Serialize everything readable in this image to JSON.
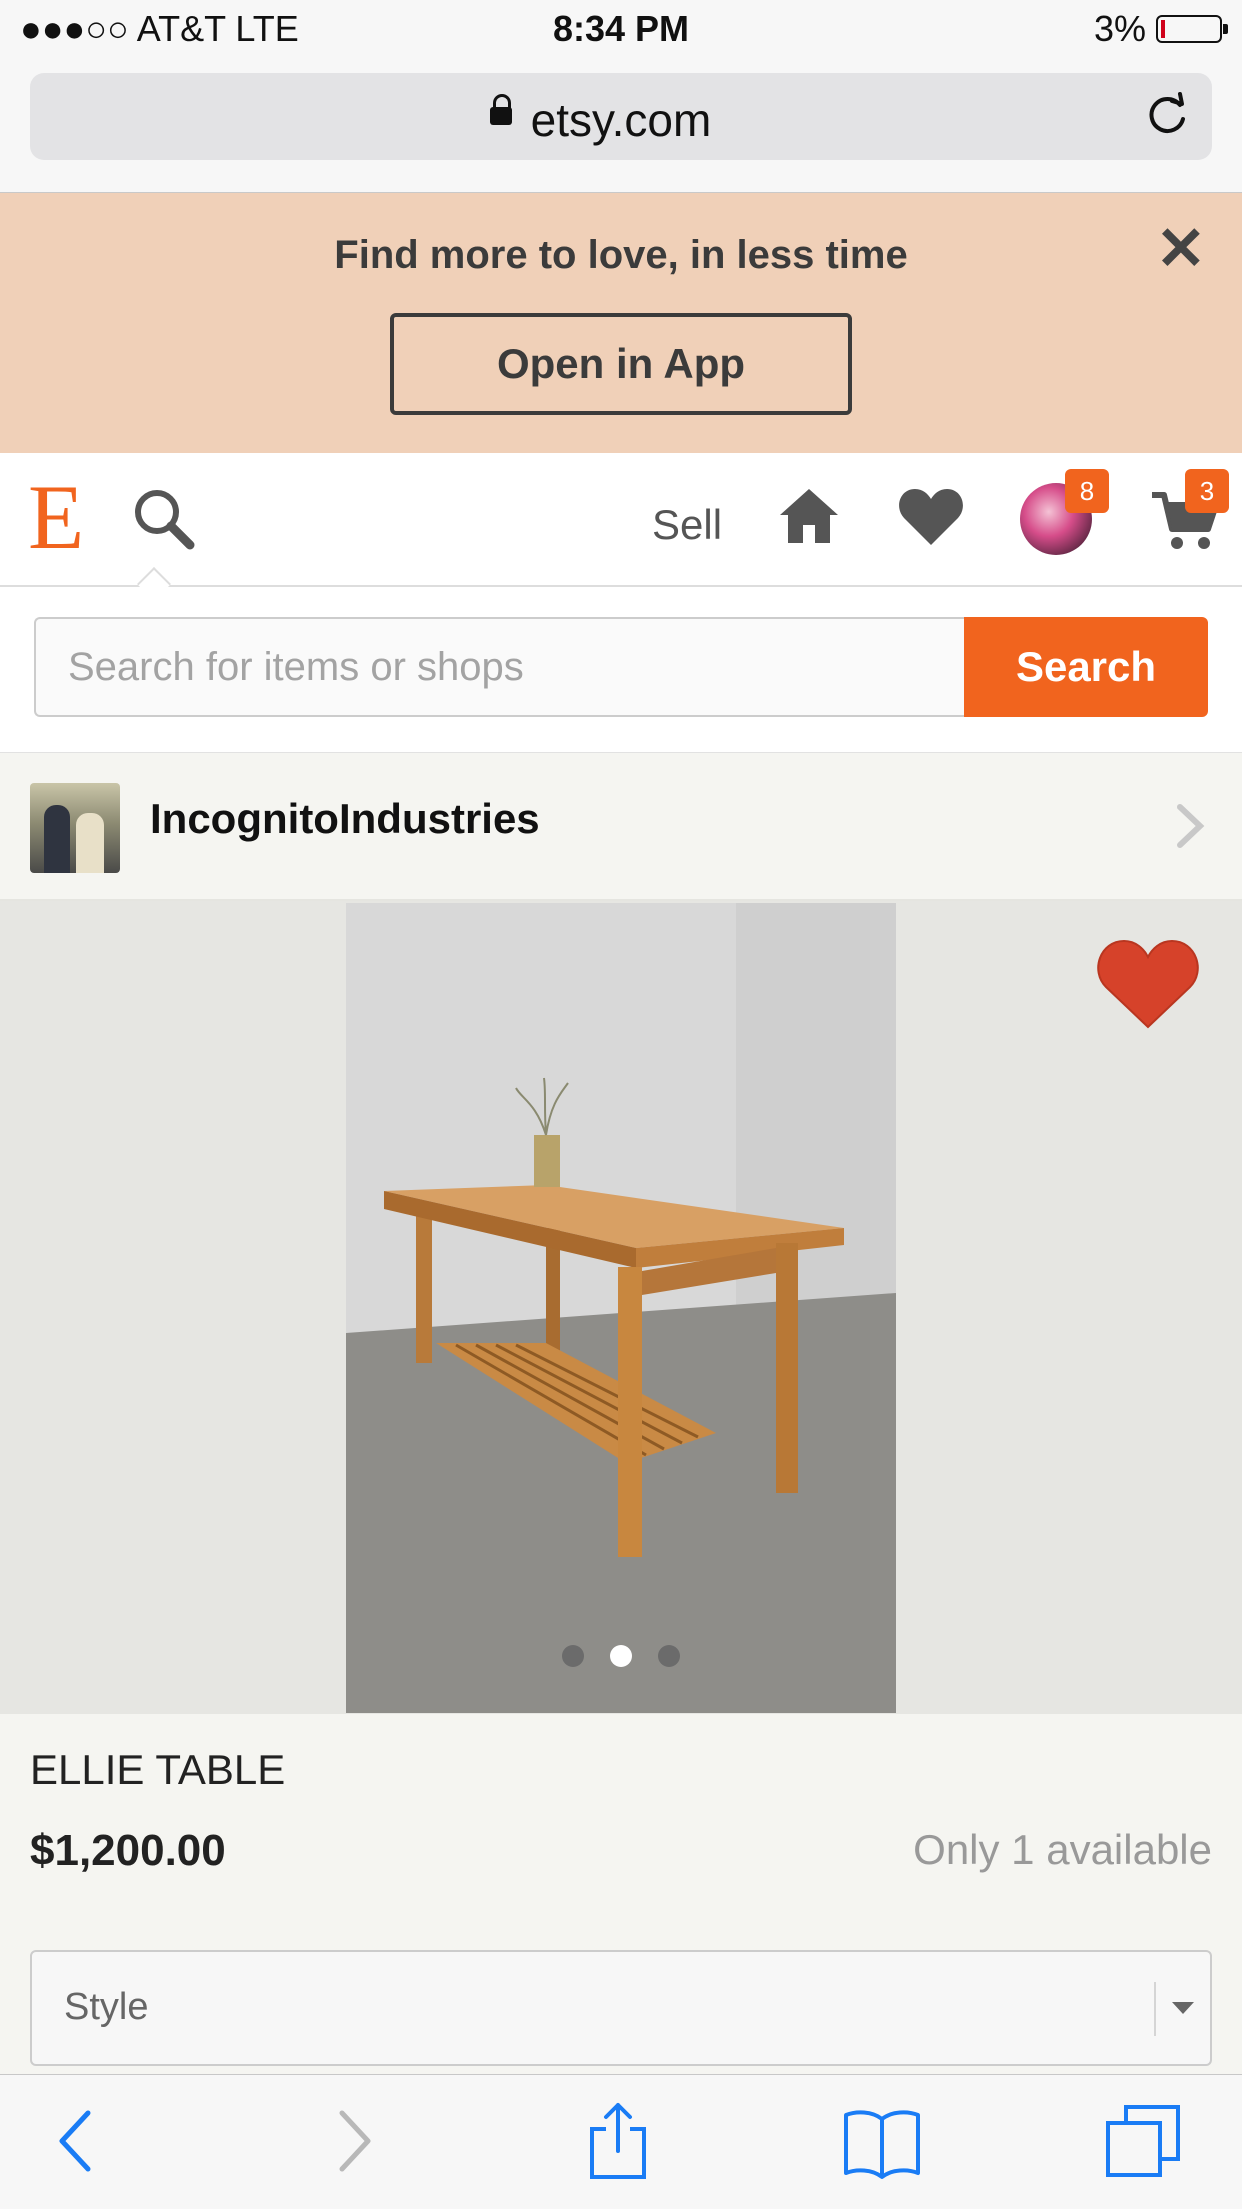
{
  "status_bar": {
    "carrier": "●●●○○ AT&T  LTE",
    "time": "8:34 PM",
    "battery": "3%"
  },
  "url_bar": {
    "domain": "etsy.com",
    "lock_icon": "lock-icon",
    "reload_icon": "reload-icon"
  },
  "banner": {
    "message": "Find more to love, in less time",
    "button_label": "Open in App",
    "close_label": "✕"
  },
  "nav": {
    "logo": "E",
    "sell_label": "Sell",
    "avatar_badge": "8",
    "cart_badge": "3",
    "accent_color": "#f1641e"
  },
  "search": {
    "placeholder": "Search for items or shops",
    "button_label": "Search"
  },
  "shop": {
    "name": "IncognitoIndustries"
  },
  "gallery": {
    "image_count": 3,
    "active_index": 1,
    "favorite_color": "#d6422a"
  },
  "listing": {
    "title": "ELLIE TABLE",
    "price": "$1,200.00",
    "availability": "Only 1 available",
    "style_select_label": "Style"
  },
  "toolbar": {
    "icons": [
      "back-icon",
      "forward-icon",
      "share-icon",
      "bookmarks-icon",
      "tabs-icon"
    ],
    "tint_color": "#1a7cf5"
  }
}
